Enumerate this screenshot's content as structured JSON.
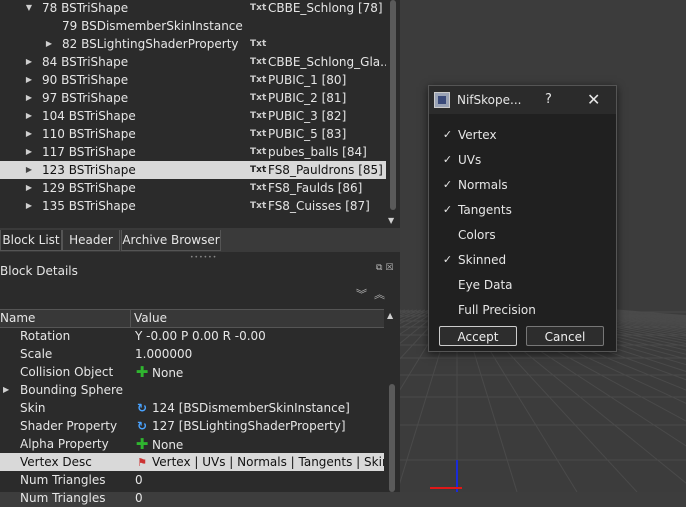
{
  "block_list": {
    "rows": [
      {
        "name": "78 BSTriShape",
        "value": "CBBE_Schlong [78]",
        "expanded": true,
        "txt": true,
        "indent": 1
      },
      {
        "name": "79 BSDismemberSkinInstance",
        "value": "",
        "expanded": null,
        "txt": false,
        "indent": 2
      },
      {
        "name": "82 BSLightingShaderProperty",
        "value": "",
        "expanded": false,
        "txt": true,
        "indent": 2
      },
      {
        "name": "84 BSTriShape",
        "value": "CBBE_Schlong_Gla...",
        "expanded": false,
        "txt": true,
        "indent": 1
      },
      {
        "name": "90 BSTriShape",
        "value": "PUBIC_1 [80]",
        "expanded": false,
        "txt": true,
        "indent": 1
      },
      {
        "name": "97 BSTriShape",
        "value": "PUBIC_2 [81]",
        "expanded": false,
        "txt": true,
        "indent": 1
      },
      {
        "name": "104 BSTriShape",
        "value": "PUBIC_3 [82]",
        "expanded": false,
        "txt": true,
        "indent": 1
      },
      {
        "name": "110 BSTriShape",
        "value": "PUBIC_5 [83]",
        "expanded": false,
        "txt": true,
        "indent": 1
      },
      {
        "name": "117 BSTriShape",
        "value": "pubes_balls [84]",
        "expanded": false,
        "txt": true,
        "indent": 1
      },
      {
        "name": "123 BSTriShape",
        "value": "FS8_Pauldrons [85]",
        "expanded": false,
        "txt": true,
        "indent": 1,
        "selected": true
      },
      {
        "name": "129 BSTriShape",
        "value": "FS8_Faulds [86]",
        "expanded": false,
        "txt": true,
        "indent": 1
      },
      {
        "name": "135 BSTriShape",
        "value": "FS8_Cuisses [87]",
        "expanded": false,
        "txt": true,
        "indent": 1
      }
    ],
    "txt_label": "Txt"
  },
  "tabs": [
    "Block List",
    "Header",
    "Archive Browser"
  ],
  "block_details": {
    "title": "Block Details",
    "columns": {
      "name": "Name",
      "value": "Value"
    },
    "rows": [
      {
        "name": "Rotation",
        "value": "Y -0.00 P 0.00 R -0.00",
        "icon": ""
      },
      {
        "name": "Scale",
        "value": "1.000000",
        "icon": ""
      },
      {
        "name": "Collision Object",
        "value": "None",
        "icon": "plus"
      },
      {
        "name": "Bounding Sphere",
        "value": "",
        "icon": "",
        "expandable": true
      },
      {
        "name": "Skin",
        "value": "124 [BSDismemberSkinInstance]",
        "icon": "link"
      },
      {
        "name": "Shader Property",
        "value": "127 [BSLightingShaderProperty]",
        "icon": "link"
      },
      {
        "name": "Alpha Property",
        "value": "None",
        "icon": "plus"
      },
      {
        "name": "Vertex Desc",
        "value": "Vertex | UVs | Normals | Tangents | Skinned",
        "icon": "flag",
        "highlight": true
      },
      {
        "name": "Num Triangles",
        "value": "0",
        "icon": ""
      },
      {
        "name": "Num Triangles",
        "value": "0",
        "icon": ""
      }
    ]
  },
  "dialog": {
    "title": "NifSkope...",
    "help": "?",
    "close": "✕",
    "options": [
      {
        "label": "Vertex",
        "checked": true
      },
      {
        "label": "UVs",
        "checked": true
      },
      {
        "label": "Normals",
        "checked": true
      },
      {
        "label": "Tangents",
        "checked": true
      },
      {
        "label": "Colors",
        "checked": false
      },
      {
        "label": "Skinned",
        "checked": true
      },
      {
        "label": "Eye Data",
        "checked": false
      },
      {
        "label": "Full Precision",
        "checked": false
      }
    ],
    "accept": "Accept",
    "cancel": "Cancel"
  },
  "colors": {
    "selection": "#d9d9d9",
    "accept_icon": "#2fb52f",
    "link_icon": "#4aa3ff",
    "axis_blue": "#1a2bd8",
    "axis_red": "#e01818"
  }
}
